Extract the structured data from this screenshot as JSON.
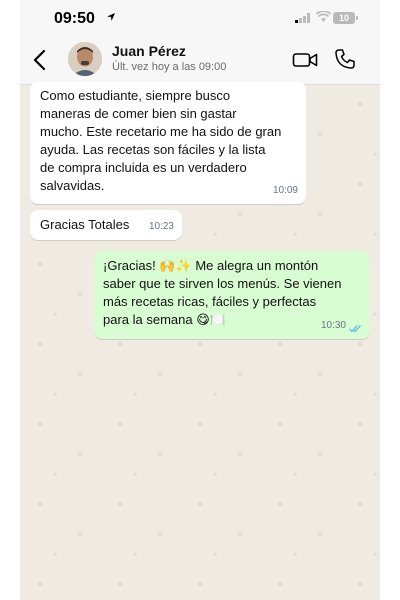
{
  "status_bar": {
    "time": "09:50",
    "battery": "10",
    "location_icon": "location-arrow-icon",
    "signal_icon": "cellular-signal-icon",
    "wifi_icon": "wifi-icon"
  },
  "header": {
    "contact_name": "Juan Pérez",
    "last_seen": "Últ. vez hoy a las 09:00",
    "back_icon": "chevron-left-icon",
    "video_icon": "video-camera-icon",
    "call_icon": "phone-icon"
  },
  "messages": [
    {
      "direction": "incoming",
      "text": "Como estudiante, siempre busco\nmaneras de comer bien sin gastar\nmucho. Este recetario me ha sido de gran\nayuda. Las recetas son fáciles y la lista\nde compra incluida es un verdadero\nsalvavidas.",
      "time": "10:09"
    },
    {
      "direction": "incoming",
      "text": "Gracias Totales",
      "time": "10:23"
    },
    {
      "direction": "outgoing",
      "text": "¡Gracias! 🙌✨ Me alegra un montón\nsaber que te sirven los menús. Se vienen\nmás recetas ricas, fáciles y perfectas\npara la semana 😋🍽️",
      "time": "10:30",
      "status": "read"
    }
  ],
  "colors": {
    "chat_background": "#efeae2",
    "outgoing_bubble": "#d9fdd3",
    "incoming_bubble": "#ffffff",
    "read_ticks": "#53bdeb"
  }
}
